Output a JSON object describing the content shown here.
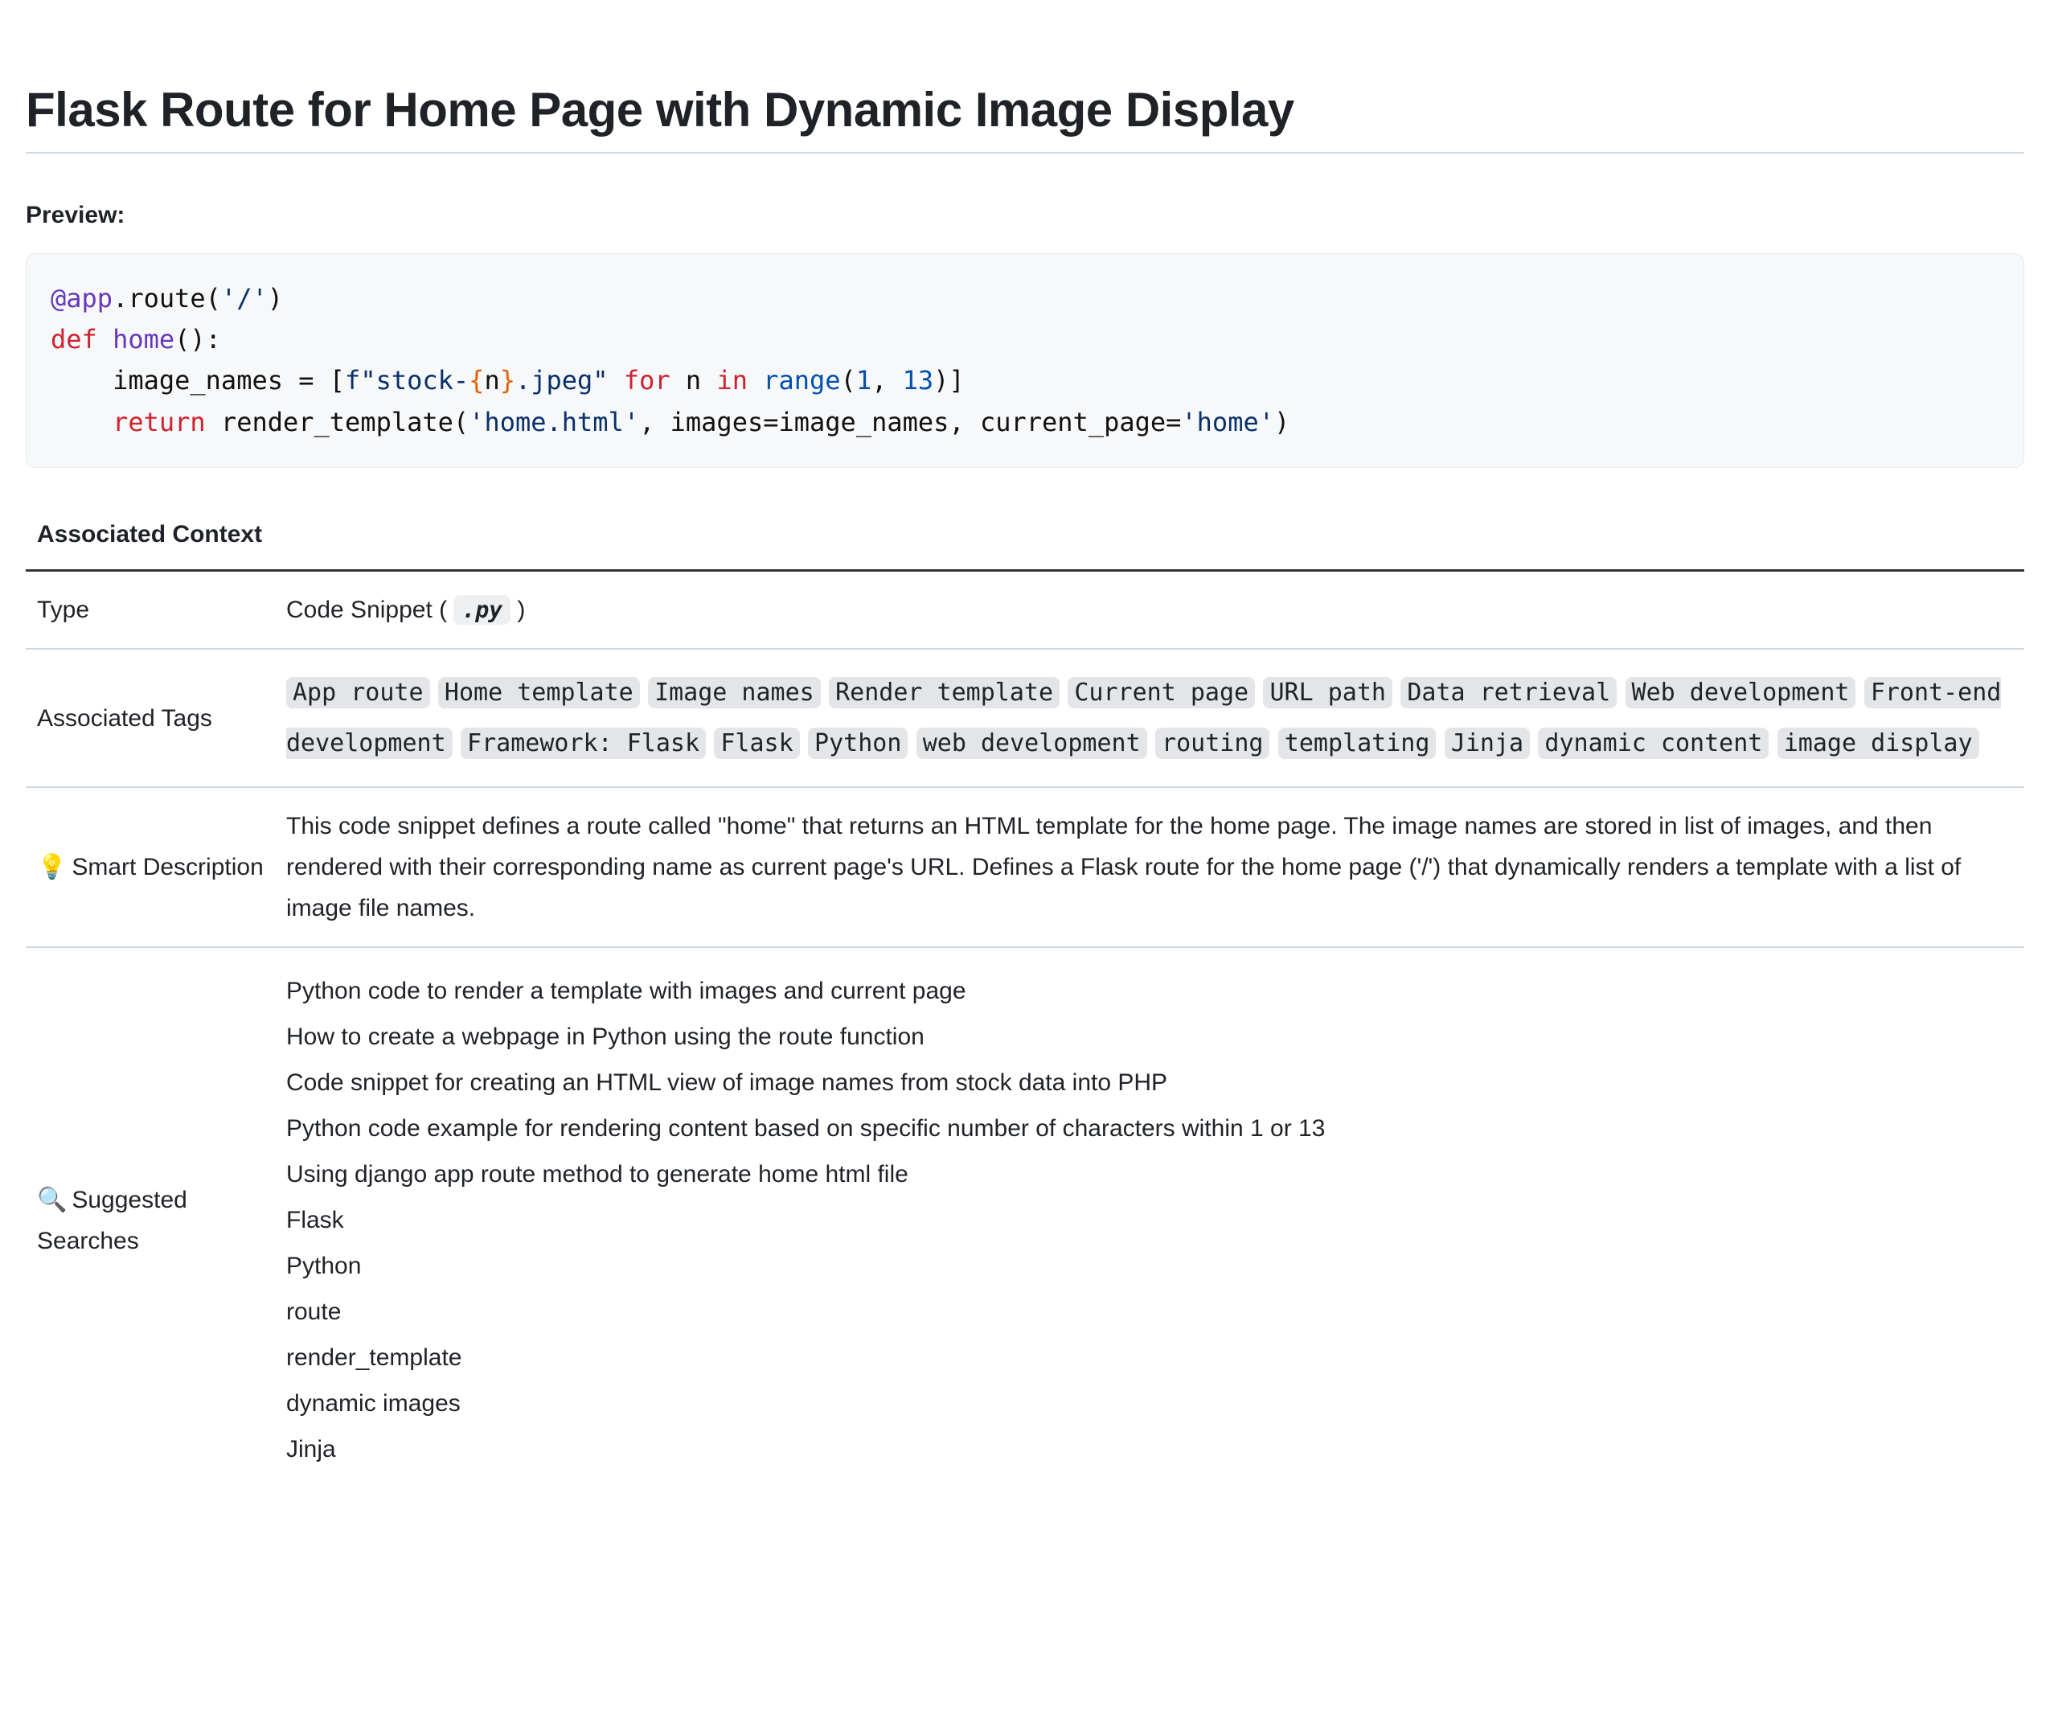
{
  "title": "Flask Route for Home Page with Dynamic Image Display",
  "preview_label": "Preview:",
  "code": {
    "decorator_at": "@app",
    "decorator_dot": ".route(",
    "route_str": "'/'",
    "decorator_close": ")",
    "kw_def": "def",
    "fn_name": "home",
    "paren": "():",
    "indent": "    ",
    "assign": "image_names = [",
    "fstr_open": "f\"stock-",
    "fstr_brace_open": "{",
    "fstr_var": "n",
    "fstr_brace_close": "}",
    "fstr_close": ".jpeg\"",
    "kw_for": "for",
    "var_n": " n ",
    "kw_in": "in",
    "builtin_range": "range",
    "range_open": "(",
    "num1": "1",
    "comma": ", ",
    "num13": "13",
    "range_close": ")]",
    "kw_return": "return",
    "render_call": " render_template(",
    "tmpl_str": "'home.html'",
    "args": ", images=image_names, current_page=",
    "cp_str": "'home'",
    "call_close": ")"
  },
  "table": {
    "header": "Associated Context",
    "rows": {
      "type": {
        "label": "Type",
        "value_prefix": "Code Snippet ( ",
        "ext": ".py",
        "value_suffix": " )"
      },
      "tags": {
        "label": "Associated Tags",
        "items": [
          "App route",
          "Home template",
          "Image names",
          "Render template",
          "Current page",
          "URL path",
          "Data retrieval",
          "Web development",
          "Front-end development",
          "Framework: Flask",
          "Flask",
          "Python",
          "web development",
          "routing",
          "templating",
          "Jinja",
          "dynamic content",
          "image display"
        ]
      },
      "smart_desc": {
        "icon": "💡",
        "label": "Smart Description",
        "text": "This code snippet defines a route called \"home\" that returns an HTML template for the home page. The image names are stored in list of images, and then rendered with their corresponding name as current page's URL. Defines a Flask route for the home page ('/') that dynamically renders a template with a list of image file names."
      },
      "suggested": {
        "icon": "🔍",
        "label": "Suggested Searches",
        "items": [
          "Python code to render a template with images and current page",
          "How to create a webpage in Python using the route function",
          "Code snippet for creating an HTML view of image names from stock data into PHP",
          "Python code example for rendering content based on specific number of characters within 1 or 13",
          "Using django app route method to generate home html file",
          "Flask",
          "Python",
          "route",
          "render_template",
          "dynamic images",
          "Jinja"
        ]
      }
    }
  }
}
